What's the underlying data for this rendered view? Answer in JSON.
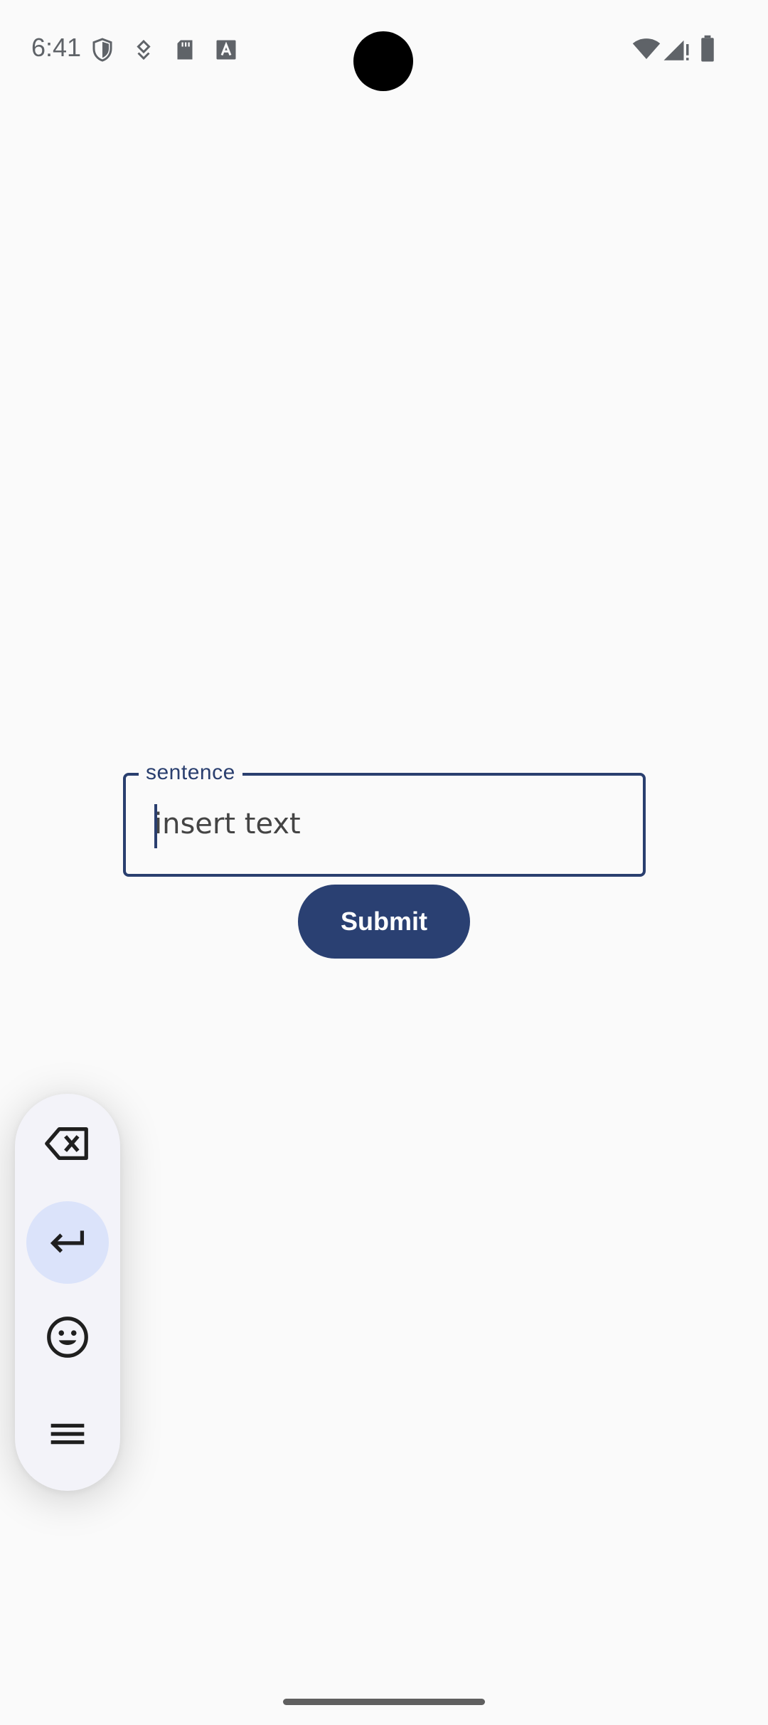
{
  "status_bar": {
    "time": "6:41",
    "left_icons": [
      "shield-icon",
      "download-icon",
      "sd-card-icon",
      "font-icon"
    ],
    "right_icons": [
      "wifi-icon",
      "cellular-signal-icon",
      "battery-icon"
    ]
  },
  "form": {
    "field_label": "sentence",
    "field_placeholder": "insert text",
    "field_value": "",
    "submit_label": "Submit"
  },
  "floating_toolbar": {
    "buttons": [
      {
        "name": "backspace-icon",
        "active": false
      },
      {
        "name": "enter-icon",
        "active": true
      },
      {
        "name": "emoji-icon",
        "active": false
      },
      {
        "name": "menu-icon",
        "active": false
      }
    ]
  },
  "colors": {
    "accent": "#2a4072",
    "background": "#fafafa",
    "toolbar_bg": "#f3f3f9",
    "active_bg": "#dbe3fa"
  }
}
